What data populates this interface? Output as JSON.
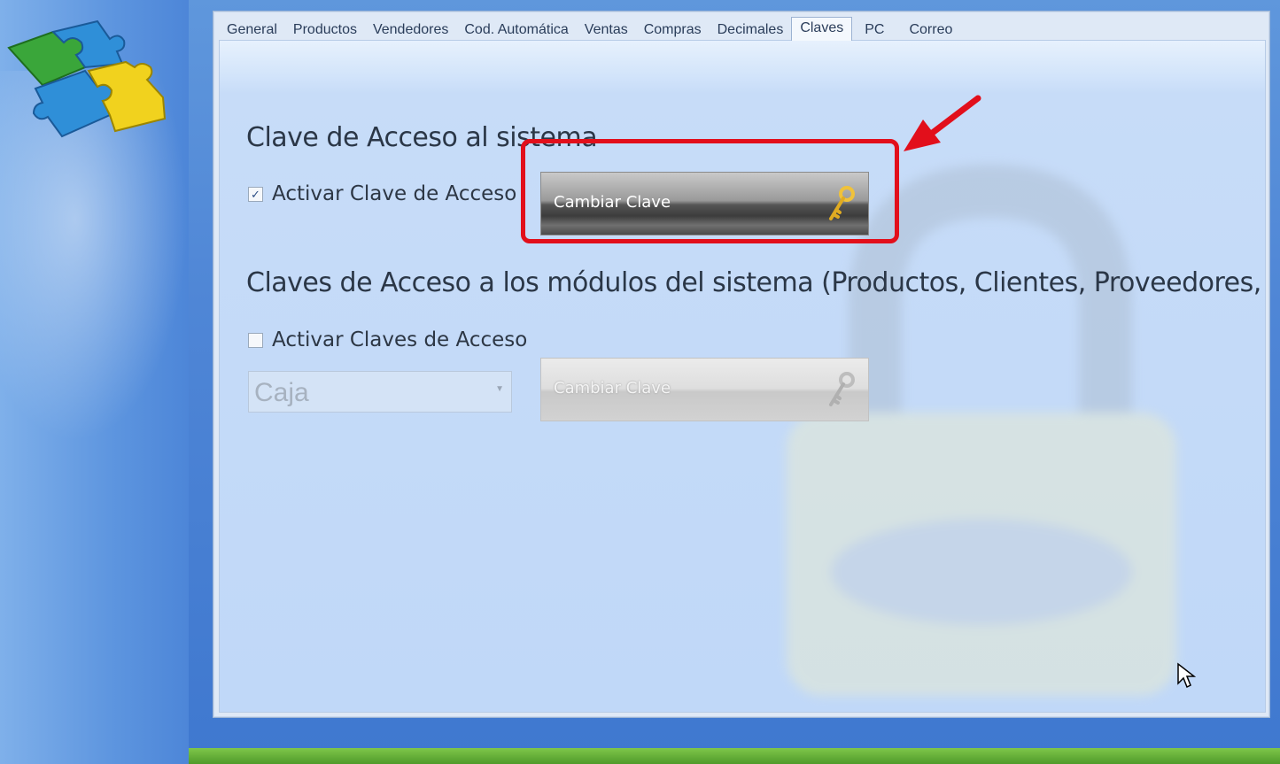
{
  "tabs": [
    "General",
    "Productos",
    "Vendedores",
    "Cod. Automática",
    "Ventas",
    "Compras",
    "Decimales",
    "Claves",
    "PC",
    "Correo"
  ],
  "active_tab": "Claves",
  "system": {
    "title": "Clave de Acceso al sistema",
    "checkbox_label": "Activar Clave de Acceso",
    "checked": true,
    "button_label": "Cambiar Clave"
  },
  "modules": {
    "title": "Claves de Acceso a los módulos del sistema (Productos, Clientes, Proveedores, etc)",
    "checkbox_label": "Activar Claves de Acceso",
    "checked": false,
    "select_value": "Caja",
    "button_label": "Cambiar Clave"
  },
  "icons": [
    "puzzle-logo-icon",
    "key-icon",
    "padlock-watermark-icon",
    "red-arrow-annotation",
    "mouse-cursor-icon"
  ],
  "colors": {
    "highlight": "#e20f1b",
    "background": "#4f86d6",
    "panel": "#c7dcf8"
  }
}
